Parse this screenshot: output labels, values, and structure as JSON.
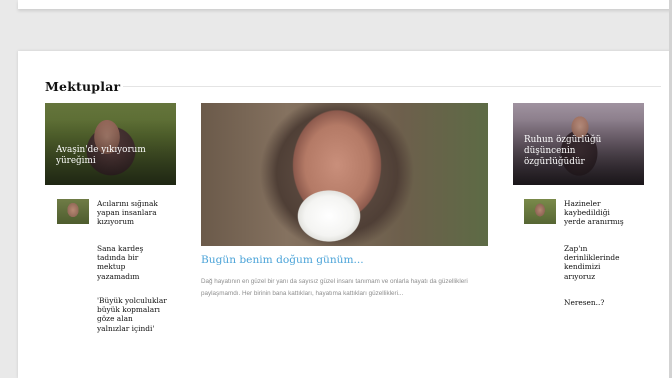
{
  "section": {
    "title": "Mektuplar"
  },
  "features": {
    "left": {
      "caption": "Avaşin'de yıkıyorum yüreğimi"
    },
    "center": {
      "title": "Bugün benim doğum günüm...",
      "excerpt": "Dağ hayatının en güzel bir yanı da sayısız güzel insanı tanımam ve onlarla hayatı da güzellikleri paylaşmamdı. Her birinin bana kattıkları, hayatıma kattıkları güzellikleri..."
    },
    "right": {
      "caption": "Ruhun özgürlüğü düşüncenin özgürlüğüdür"
    }
  },
  "left_list": [
    {
      "label": "Acılarını sığınak yapan insanlara kızıyorum"
    },
    {
      "label": "Sana kardeş tadında bir mektup yazamadım"
    },
    {
      "label": "'Büyük yolculuklar büyük kopmaları göze alan yalnızlar içindi'"
    }
  ],
  "right_list": [
    {
      "label": "Hazineler kaybedildiği yerde aranırmış"
    },
    {
      "label": "Zap'ın derinliklerinde kendimizi arıyoruz"
    },
    {
      "label": "Neresen..?"
    }
  ]
}
